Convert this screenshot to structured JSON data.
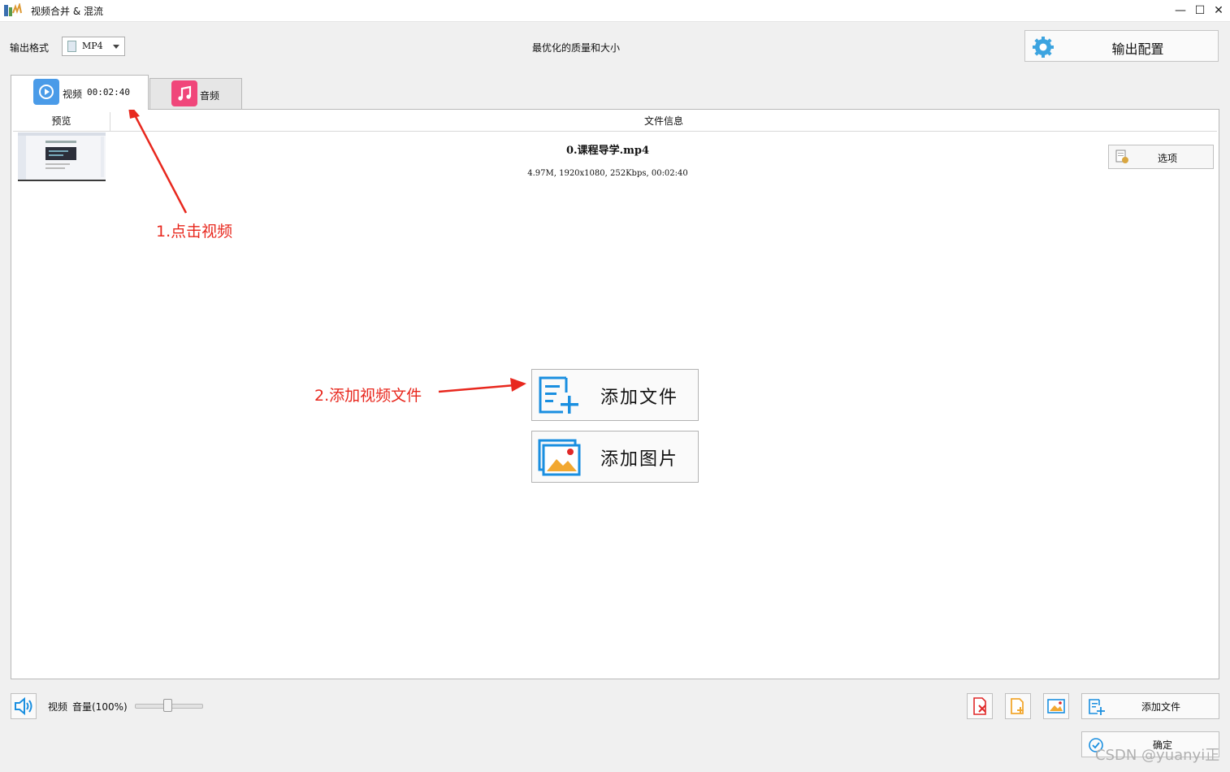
{
  "window": {
    "title": "视频合并 & 混流",
    "controls": {
      "minimize": "—",
      "maximize": "☐",
      "close": "✕"
    }
  },
  "toolbar": {
    "format_label": "输出格式",
    "format_value": "MP4",
    "quality_text": "最优化的质量和大小",
    "output_config_label": "输出配置"
  },
  "tabs": [
    {
      "label": "视频",
      "duration": "00:02:40",
      "icon": "play-circle-icon",
      "active": true
    },
    {
      "label": "音频",
      "icon": "music-note-icon",
      "active": false
    }
  ],
  "table": {
    "columns": [
      "预览",
      "文件信息"
    ],
    "rows": [
      {
        "file_name": "0.课程导学.mp4",
        "meta": "4.97M, 1920x1080, 252Kbps, 00:02:40",
        "options_label": "选项"
      }
    ]
  },
  "center_buttons": {
    "add_file": "添加文件",
    "add_image": "添加图片"
  },
  "annotations": {
    "step1": "1.点击视频",
    "step2": "2.添加视频文件"
  },
  "bottom": {
    "track_label": "视频",
    "volume_label": "音量(100%)",
    "volume": 100,
    "add_file_label": "添加文件",
    "confirm_label": "确定"
  },
  "watermark": "CSDN @yuanyi正",
  "colors": {
    "accent_blue": "#4a9be8",
    "audio_pink": "#f0467a",
    "annotation_red": "#e8281e",
    "icon_blue": "#1a8fe0",
    "icon_orange": "#f2a830"
  }
}
